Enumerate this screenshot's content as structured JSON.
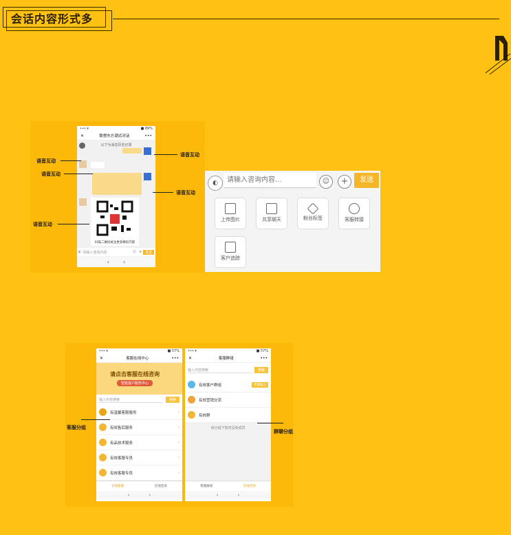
{
  "header": {
    "title": "会话内容形式多"
  },
  "chat_demo": {
    "nav_title": "联想东方潮式对话",
    "subtitle": "以下为消息历史记录",
    "annotations": [
      "语音互动",
      "语音互动",
      "语音互动",
      "语音互动",
      "语音互动"
    ],
    "input_placeholder": "请输入咨询内容",
    "send_label": "发送",
    "qr_caption": "扫描二维码关注更多精彩内容"
  },
  "input_panel": {
    "placeholder": "请输入咨询内容...",
    "send_label": "发送",
    "tools": [
      {
        "label": "上传图片",
        "icon": "image-icon"
      },
      {
        "label": "共享聊天",
        "icon": "screen-icon"
      },
      {
        "label": "粉丝标签",
        "icon": "tag-icon"
      },
      {
        "label": "客服转接",
        "icon": "link-icon"
      },
      {
        "label": "客户追踪",
        "icon": "screen-icon"
      }
    ]
  },
  "service_group": {
    "nav_title": "客服在线中心",
    "banner_title": "请点击客服在线咨询",
    "banner_button": "智能客户服务中心",
    "search_placeholder": "输入内容搜索",
    "search_button": "搜索",
    "items": [
      "有温馨客服服务",
      "有效售后服务",
      "有品技术服务",
      "有效客服专员",
      "有效客服专员"
    ],
    "tabs": [
      "在线客服",
      "在线咨询"
    ],
    "annotation": "客服分组"
  },
  "group_list": {
    "nav_title": "客服群组",
    "search_placeholder": "输入内容搜索",
    "search_button": "搜索",
    "items": [
      "有效客户群组",
      "有效营销交流",
      "有效群"
    ],
    "join_label": "申请加入",
    "footer_text": "该分组下暂时没有成员",
    "tabs": [
      "客服群组",
      "在线咨询"
    ],
    "annotation": "群聊分组"
  },
  "colors": {
    "background": "#FFC212",
    "accent": "#F7B52A"
  }
}
